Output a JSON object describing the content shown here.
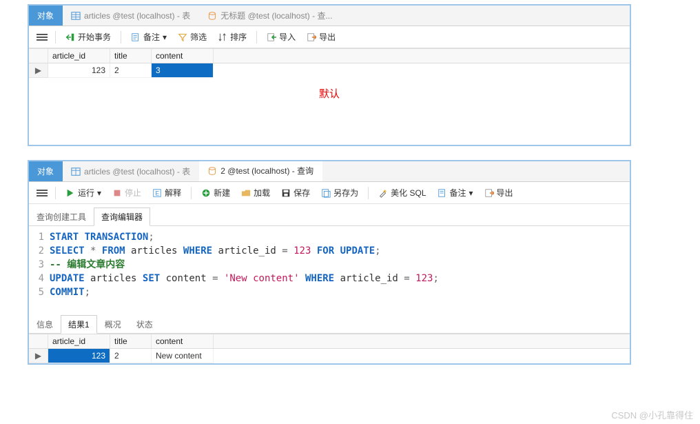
{
  "panel1": {
    "tabs": {
      "obj": "对象",
      "table": "articles @test (localhost) - 表",
      "untitled": "无标题 @test (localhost) - 查..."
    },
    "toolbar": {
      "begin_trans": "开始事务",
      "memo": "备注",
      "filter": "筛选",
      "sort": "排序",
      "import": "导入",
      "export": "导出"
    },
    "cols": {
      "c1": "article_id",
      "c2": "title",
      "c3": "content"
    },
    "row": {
      "id": "123",
      "title": "2",
      "content": "3"
    },
    "note": "默认"
  },
  "panel2": {
    "tabs": {
      "obj": "对象",
      "table": "articles @test (localhost) - 表",
      "query": "2 @test (localhost) - 查询"
    },
    "toolbar": {
      "run": "运行",
      "stop": "停止",
      "explain": "解释",
      "new": "新建",
      "load": "加载",
      "save": "保存",
      "saveas": "另存为",
      "beautify": "美化 SQL",
      "memo": "备注",
      "export": "导出"
    },
    "subtabs": {
      "builder": "查询创建工具",
      "editor": "查询编辑器"
    },
    "sql_tokens": {
      "l1": {
        "a": "START",
        "b": "TRANSACTION",
        "c": ";"
      },
      "l2": {
        "a": "SELECT",
        "b": "*",
        "c": "FROM",
        "d": "articles",
        "e": "WHERE",
        "f": "article_id",
        "g": "=",
        "h": "123",
        "i": "FOR",
        "j": "UPDATE",
        "k": ";"
      },
      "l3": {
        "a": "-- 编辑文章内容"
      },
      "l4": {
        "a": "UPDATE",
        "b": "articles",
        "c": "SET",
        "d": "content",
        "e": "=",
        "f": "'New content'",
        "g": "WHERE",
        "h": "article_id",
        "i": "=",
        "j": "123",
        "k": ";"
      },
      "l5": {
        "a": "COMMIT",
        "b": ";"
      }
    },
    "ln": {
      "n1": "1",
      "n2": "2",
      "n3": "3",
      "n4": "4",
      "n5": "5"
    },
    "result_tabs": {
      "info": "信息",
      "res1": "结果1",
      "profile": "概况",
      "status": "状态"
    },
    "cols": {
      "c1": "article_id",
      "c2": "title",
      "c3": "content"
    },
    "row": {
      "id": "123",
      "title": "2",
      "content": "New content"
    }
  },
  "watermark": "CSDN @小孔靠得住",
  "chart_data": {
    "type": "table",
    "tables": [
      {
        "columns": [
          "article_id",
          "title",
          "content"
        ],
        "rows": [
          [
            123,
            "2",
            "3"
          ]
        ]
      },
      {
        "columns": [
          "article_id",
          "title",
          "content"
        ],
        "rows": [
          [
            123,
            "2",
            "New content"
          ]
        ]
      }
    ],
    "sql": "START TRANSACTION;\nSELECT * FROM articles WHERE article_id = 123 FOR UPDATE;\n-- 编辑文章内容\nUPDATE articles SET content = 'New content' WHERE article_id = 123;\nCOMMIT;"
  }
}
